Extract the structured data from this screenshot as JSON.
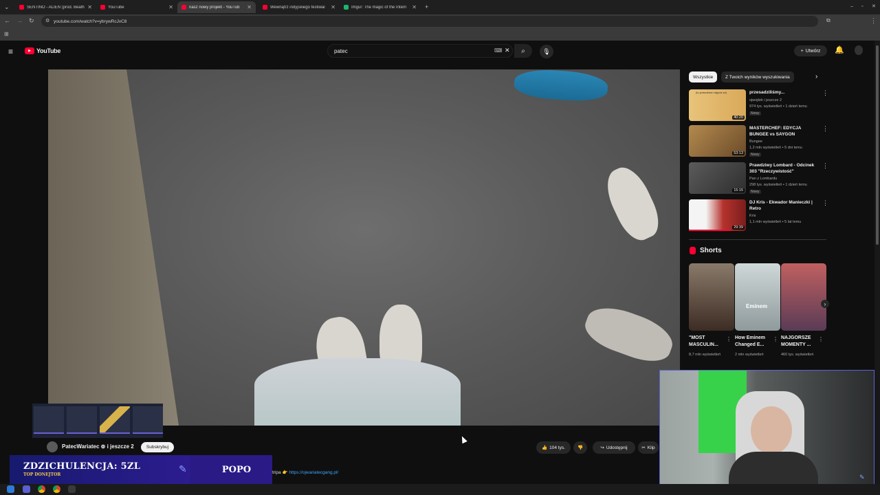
{
  "browser": {
    "tabs": [
      {
        "label": "SENTINO - ALIEN (prod. Beath",
        "color": "#ff0033"
      },
      {
        "label": "YouTube",
        "color": "#ff0033"
      },
      {
        "label": "nasz nowy projekt - YouTub",
        "color": "#ff0033"
      },
      {
        "label": "Wewnątrz indyjskiego festiwal",
        "color": "#ff0033"
      },
      {
        "label": "Imgur: The magic of the Intern",
        "color": "#1bb76e"
      }
    ],
    "url": "youtube.com/watch?v=ybrywRcJvC8",
    "new_tab_icon": "plus-icon"
  },
  "youtube": {
    "logo_text": "YouTube",
    "search_value": "patec",
    "create_label": "Utwórz",
    "icons": {
      "menu": "menu-icon",
      "search": "search-icon",
      "mic": "mic-icon",
      "bell": "bell-icon",
      "keyboard": "keyboard-icon",
      "clear": "close-icon"
    }
  },
  "video": {
    "channel": "PatecWariatec",
    "channel_suffix": "i jeszcze 2",
    "subscribe_label": "Subskrybuj",
    "likes": "104 tys.",
    "share_label": "Udostępnij",
    "clip_label": "Klip",
    "description_prefix": "tripa 👉",
    "description_link": "https://ojwariatecgang.pl/"
  },
  "donation": {
    "title": "ZDZICHULENCJA: 5ZL",
    "subtitle": "TOP DONEJTOR",
    "name": "POPO"
  },
  "sidebar": {
    "chips": [
      {
        "label": "Wszystkie",
        "active": true
      },
      {
        "label": "Z Twoich wyników wyszukiwania",
        "active": false
      }
    ],
    "recommendations": [
      {
        "title": "przesadziliśmy...",
        "channel": "ojwojtek",
        "channel_suffix": "i jeszcze 2",
        "meta": "974 tys. wyświetleń • 1 dzień temu",
        "badge": "Nowy",
        "duration": "40:20",
        "thumb_caption": "(to prawdziwe zdjęcia sd)"
      },
      {
        "title": "MASTERCHEF: EDYCJA BUNGEE vs SAYGON",
        "channel": "Bungee",
        "meta": "1,2 mln wyświetleń • 5 dni temu",
        "badge": "Nowy",
        "duration": "53:13"
      },
      {
        "title": "Prawdziwy Lombard - Odcinek 303 \"Rzeczywistość\"",
        "channel": "Pan z Lombardu",
        "meta": "298 tys. wyświetleń • 1 dzień temu",
        "badge": "Nowy",
        "duration": "15:15"
      },
      {
        "title": "DJ Kris - Ekwador Manieczki | Retro",
        "channel": "Kris",
        "meta": "1,1 mln wyświetleń • 5 lat temu",
        "badge": "",
        "duration": "29:39"
      }
    ],
    "shorts_label": "Shorts",
    "shorts": [
      {
        "title": "\"MOST MASCULIN...",
        "views": "8,7 mln wyświetleń",
        "caption": ""
      },
      {
        "title": "How Eminem Changed E...",
        "views": "2 mln wyświetleń",
        "caption": "Eminem"
      },
      {
        "title": "NAJGORSZE MOMENTY ...",
        "views": "460 tys. wyświetleń",
        "caption": ""
      }
    ]
  },
  "colors": {
    "yt_red": "#ff0033",
    "link": "#3ea6ff",
    "donation_bg": "#2a1a86",
    "cam_border": "#5e63d6"
  }
}
